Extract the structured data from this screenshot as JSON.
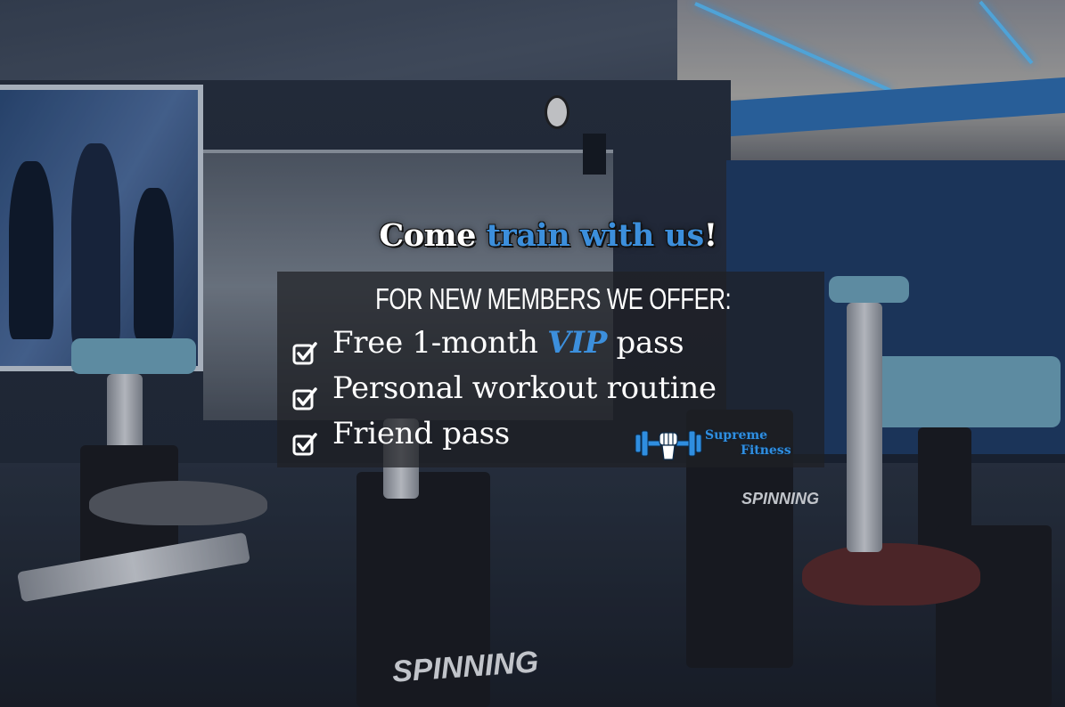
{
  "headline": {
    "prefix": "Come",
    "accent": "train with us",
    "suffix": "!"
  },
  "offer": {
    "title": "FOR NEW MEMBERS WE OFFER:",
    "items": [
      {
        "before": "Free 1-month ",
        "highlight": "VIP",
        "after": " pass"
      },
      {
        "before": "Personal workout routine",
        "highlight": "",
        "after": ""
      },
      {
        "before": "Friend pass",
        "highlight": "",
        "after": ""
      }
    ]
  },
  "logo": {
    "line1": "Supreme",
    "line2": "Fitness",
    "icon": "dumbbell-fist-icon"
  },
  "background_brand_text": "SPINNING",
  "colors": {
    "accent": "#3c8fdc",
    "panel": "#1e2024",
    "text": "#ffffff",
    "led": "#5fc4ff"
  }
}
